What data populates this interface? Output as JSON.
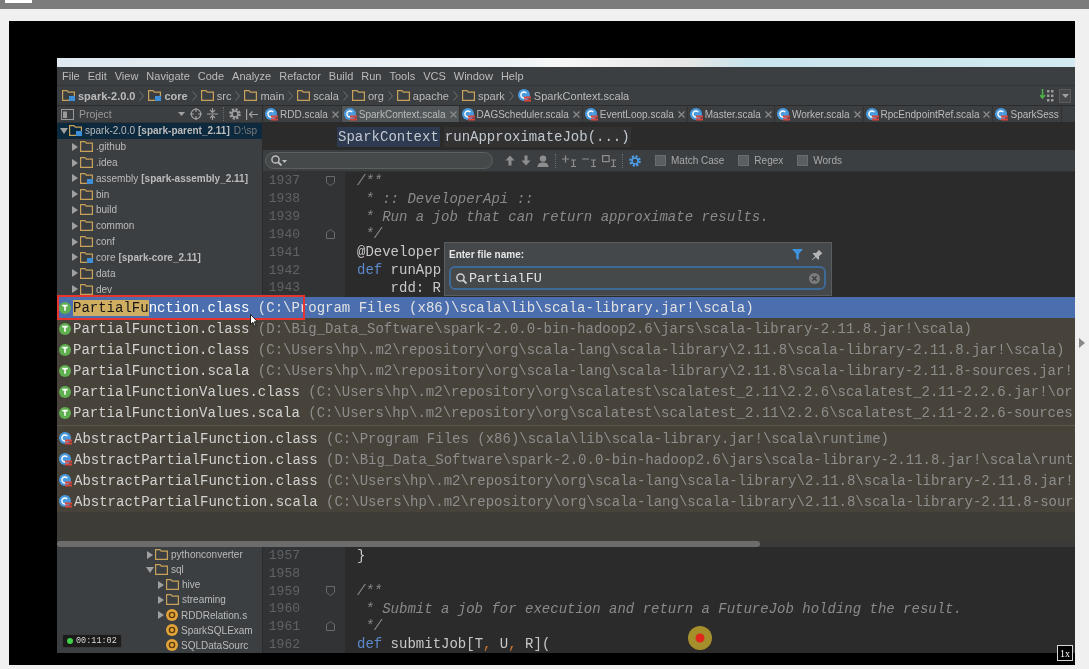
{
  "player": {
    "timestamp": "00:11:02",
    "speed": "1x"
  },
  "ide": {
    "menu": [
      "File",
      "Edit",
      "View",
      "Navigate",
      "Code",
      "Analyze",
      "Refactor",
      "Build",
      "Run",
      "Tools",
      "VCS",
      "Window",
      "Help"
    ],
    "nav": [
      {
        "label": "spark-2.0.0",
        "kind": "module"
      },
      {
        "label": "core",
        "kind": "module"
      },
      {
        "label": "src",
        "kind": "folder"
      },
      {
        "label": "main",
        "kind": "folder"
      },
      {
        "label": "scala",
        "kind": "folder"
      },
      {
        "label": "org",
        "kind": "folder"
      },
      {
        "label": "apache",
        "kind": "folder"
      },
      {
        "label": "spark",
        "kind": "folder"
      },
      {
        "label": "SparkContext.scala",
        "kind": "file"
      }
    ],
    "project_panel": {
      "title": "Project"
    },
    "tree": [
      {
        "label": "spark-2.0.0",
        "tag": "[spark-parent_2.11]",
        "path": "D:\\sp",
        "kind": "module",
        "expanded": true,
        "selected": true,
        "children": [
          {
            "label": ".github",
            "kind": "folder",
            "expanded": false,
            "selected": false
          },
          {
            "label": ".idea",
            "kind": "folder",
            "expanded": false,
            "selected": false
          },
          {
            "label": "assembly",
            "tag": "[spark-assembly_2.11]",
            "kind": "module",
            "expanded": false,
            "selected": false
          },
          {
            "label": "bin",
            "kind": "folder",
            "expanded": false,
            "selected": false
          },
          {
            "label": "build",
            "kind": "folder",
            "expanded": false,
            "selected": false
          },
          {
            "label": "common",
            "kind": "folder",
            "expanded": false,
            "selected": false
          },
          {
            "label": "conf",
            "kind": "folder",
            "expanded": false,
            "selected": false
          },
          {
            "label": "core",
            "tag": "[spark-core_2.11]",
            "kind": "module",
            "expanded": false,
            "selected": false
          },
          {
            "label": "data",
            "kind": "folder",
            "expanded": false,
            "selected": false
          },
          {
            "label": "dev",
            "kind": "folder",
            "expanded": false,
            "selected": false
          }
        ]
      }
    ],
    "tabs": [
      {
        "label": "RDD.scala",
        "selected": false,
        "closable": true
      },
      {
        "label": "SparkContext.scala",
        "selected": true,
        "closable": true
      },
      {
        "label": "DAGScheduler.scala",
        "selected": false,
        "closable": true
      },
      {
        "label": "EventLoop.scala",
        "selected": false,
        "closable": true
      },
      {
        "label": "Master.scala",
        "selected": false,
        "closable": true
      },
      {
        "label": "Worker.scala",
        "selected": false,
        "closable": true
      },
      {
        "label": "RpcEndpointRef.scala",
        "selected": false,
        "closable": true
      },
      {
        "label": "SparkSess",
        "selected": false,
        "closable": false
      }
    ],
    "code_breadcrumb": [
      {
        "label": "SparkContext",
        "kind": "class"
      },
      {
        "label": "runApproximateJob(...)",
        "kind": "method"
      }
    ],
    "find_bar": {
      "options": [
        {
          "label": "Match Case",
          "checked": false
        },
        {
          "label": "Regex",
          "checked": false
        },
        {
          "label": "Words",
          "checked": false
        }
      ]
    },
    "code_top": [
      {
        "number": "1937",
        "fold_start": true,
        "tokens": [
          {
            "text": "/**",
            "kind": "doc"
          }
        ]
      },
      {
        "number": "1938",
        "tokens": [
          {
            "text": " * :: DeveloperApi ::",
            "kind": "doc"
          }
        ]
      },
      {
        "number": "1939",
        "tokens": [
          {
            "text": " * Run a job that can return approximate results.",
            "kind": "doc"
          }
        ]
      },
      {
        "number": "1940",
        "fold_end": true,
        "tokens": [
          {
            "text": " */",
            "kind": "doc"
          }
        ]
      },
      {
        "number": "1941",
        "tokens": [
          {
            "text": "@Developer",
            "kind": "plain"
          }
        ]
      },
      {
        "number": "1942",
        "tokens": [
          {
            "text": "def",
            "kind": "keyword"
          },
          {
            "text": " runApp",
            "kind": "plain"
          }
        ]
      },
      {
        "number": "1943",
        "tokens": [
          {
            "text": "    rdd: R",
            "kind": "plain"
          }
        ]
      }
    ],
    "file_popup": {
      "title": "Enter file name:",
      "query": "PartialFU"
    },
    "results": [
      {
        "items": [
          {
            "kind": "trait",
            "match": "PartialFu",
            "name": "nction.class",
            "path": "(C:\\Program Files (x86)\\scala\\lib\\scala-library.jar!\\scala)",
            "selected": true
          },
          {
            "kind": "trait",
            "name": "PartialFunction.class",
            "path": "(D:\\Big_Data_Software\\spark-2.0.0-bin-hadoop2.6\\jars\\scala-library-2.11.8.jar!\\scala)",
            "selected": false
          },
          {
            "kind": "trait",
            "name": "PartialFunction.class",
            "path": "(C:\\Users\\hp\\.m2\\repository\\org\\scala-lang\\scala-library\\2.11.8\\scala-library-2.11.8.jar!\\scala)",
            "selected": false
          },
          {
            "kind": "trait",
            "name": "PartialFunction.scala",
            "path": "(C:\\Users\\hp\\.m2\\repository\\org\\scala-lang\\scala-library\\2.11.8\\scala-library-2.11.8-sources.jar!",
            "selected": false
          },
          {
            "kind": "trait",
            "name": "PartialFunctionValues.class",
            "path": "(C:\\Users\\hp\\.m2\\repository\\org\\scalatest\\scalatest_2.11\\2.2.6\\scalatest_2.11-2.2.6.jar!\\or",
            "selected": false
          },
          {
            "kind": "trait",
            "name": "PartialFunctionValues.scala",
            "path": "(C:\\Users\\hp\\.m2\\repository\\org\\scalatest\\scalatest_2.11\\2.2.6\\scalatest_2.11-2.2.6-sources",
            "selected": false
          }
        ]
      },
      {
        "items": [
          {
            "kind": "class",
            "name": "AbstractPartialFunction.class",
            "path": "(C:\\Program Files (x86)\\scala\\lib\\scala-library.jar!\\scala\\runtime)",
            "selected": false
          },
          {
            "kind": "class",
            "name": "AbstractPartialFunction.class",
            "path": "(D:\\Big_Data_Software\\spark-2.0.0-bin-hadoop2.6\\jars\\scala-library-2.11.8.jar!\\scala\\runt",
            "selected": false
          },
          {
            "kind": "class",
            "name": "AbstractPartialFunction.class",
            "path": "(C:\\Users\\hp\\.m2\\repository\\org\\scala-lang\\scala-library\\2.11.8\\scala-library-2.11.8.jar!",
            "selected": false
          },
          {
            "kind": "class",
            "name": "AbstractPartialFunction.scala",
            "path": "(C:\\Users\\hp\\.m2\\repository\\org\\scala-lang\\scala-library\\2.11.8\\scala-library-2.11.8-sour",
            "selected": false
          }
        ]
      }
    ],
    "tree_lower": [
      {
        "label": "pythonconverter",
        "kind": "folder",
        "expanded": false,
        "selected": false
      },
      {
        "label": "sql",
        "kind": "folder",
        "expanded": true,
        "selected": false,
        "children": [
          {
            "label": "hive",
            "kind": "folder",
            "expanded": false,
            "selected": false
          },
          {
            "label": "streaming",
            "kind": "folder",
            "expanded": false,
            "selected": false
          },
          {
            "label": "RDDRelation.s",
            "kind": "object",
            "expanded": false,
            "selected": false
          },
          {
            "label": "SparkSQLExam",
            "kind": "object",
            "selected": false
          },
          {
            "label": "SQLDataSourc",
            "kind": "object",
            "selected": false
          }
        ]
      }
    ],
    "code_bottom": [
      {
        "number": "1957",
        "tokens": [
          {
            "text": "}",
            "kind": "plain"
          }
        ]
      },
      {
        "number": "1958"
      },
      {
        "number": "1959",
        "fold_start": true,
        "tokens": [
          {
            "text": "/**",
            "kind": "doc"
          }
        ]
      },
      {
        "number": "1960",
        "tokens": [
          {
            "text": " * Submit a job for execution and return a FutureJob holding the result.",
            "kind": "doc"
          }
        ]
      },
      {
        "number": "1961",
        "fold_end": true,
        "tokens": [
          {
            "text": " */",
            "kind": "doc"
          }
        ]
      },
      {
        "number": "1962",
        "tokens": [
          {
            "text": "def",
            "kind": "keyword"
          },
          {
            "text": " submitJob[T",
            "kind": "plain"
          },
          {
            "text": ",",
            "kind": "punct"
          },
          {
            "text": " U",
            "kind": "plain"
          },
          {
            "text": ",",
            "kind": "punct"
          },
          {
            "text": " R](",
            "kind": "plain"
          }
        ]
      }
    ]
  }
}
